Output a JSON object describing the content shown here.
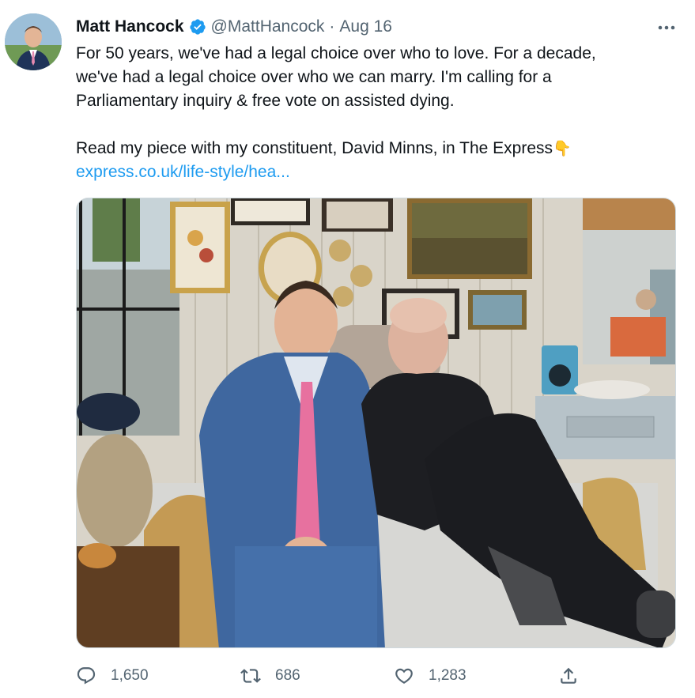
{
  "tweet": {
    "author": {
      "name": "Matt Hancock",
      "handle": "@MattHancock",
      "verified": true
    },
    "separator": "·",
    "date": "Aug 16",
    "text_lines": [
      "For 50 years, we've had a legal choice over who to love. For a decade,",
      "we've had a legal choice over who we can marry. I'm calling for a",
      "Parliamentary inquiry & free vote on assisted dying."
    ],
    "text_line_2": "Read my piece with my constituent, David Minns, in The Express",
    "emoji": "👇",
    "link": "express.co.uk/life-style/hea..."
  },
  "actions": {
    "reply_count": "1,650",
    "retweet_count": "686",
    "like_count": "1,283"
  },
  "colors": {
    "accent": "#1d9bf0",
    "secondary_text": "#536471",
    "primary_text": "#0f1419"
  },
  "icons": [
    "verified-badge-icon",
    "more-icon",
    "reply-icon",
    "retweet-icon",
    "like-icon",
    "share-icon"
  ]
}
